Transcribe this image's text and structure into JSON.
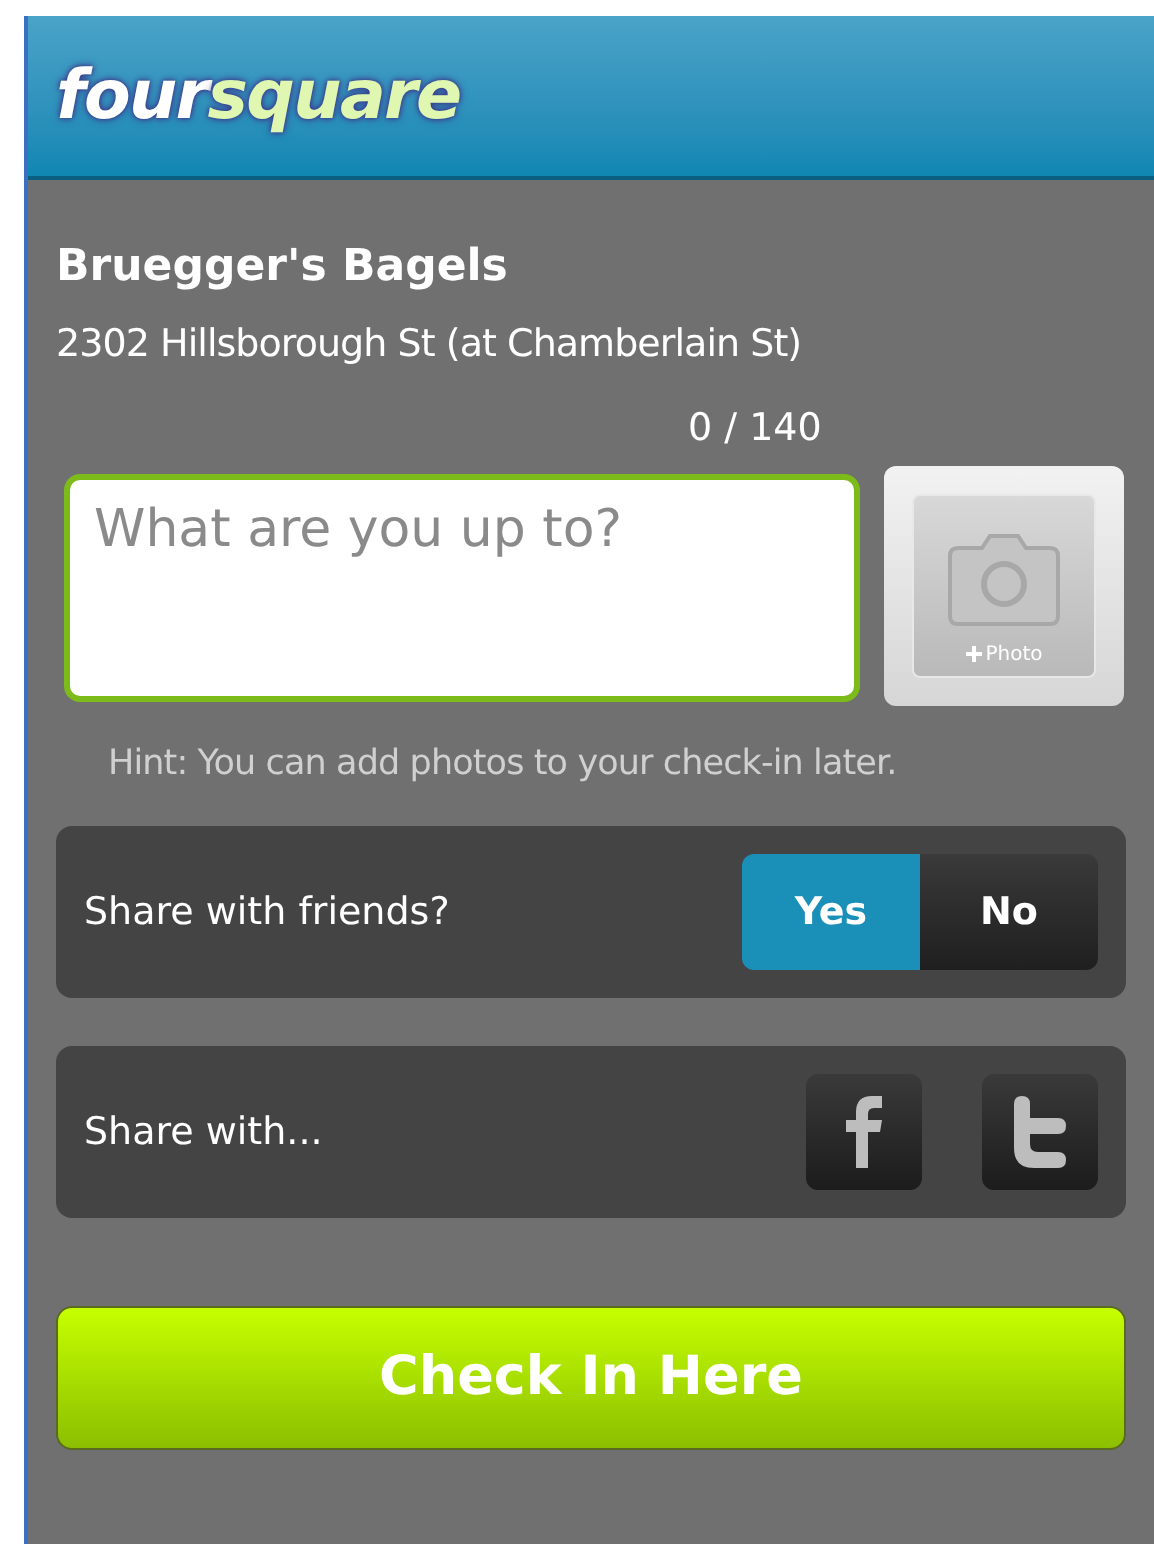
{
  "header": {
    "logo": [
      "four",
      "square"
    ]
  },
  "venue": {
    "name": "Bruegger's Bagels",
    "address": "2302 Hillsborough St (at Chamberlain St)"
  },
  "counter": "0 / 140",
  "shout": {
    "placeholder": "What are you up to?"
  },
  "photo_button": {
    "label": "Photo"
  },
  "hint": "Hint: You can add photos to your check-in later.",
  "share_friends": {
    "label": "Share with friends?",
    "options": [
      {
        "label": "Yes",
        "selected": true
      },
      {
        "label": "No",
        "selected": false
      }
    ]
  },
  "share_with": {
    "label": "Share with..."
  },
  "check_in_button": "Check In Here"
}
